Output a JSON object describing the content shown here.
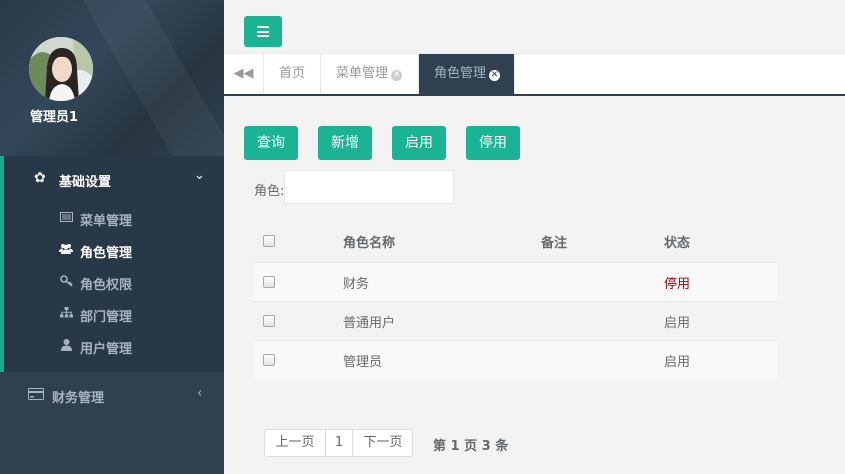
{
  "profile": {
    "name": "管理员1"
  },
  "sidebar": {
    "group": {
      "label": "基础设置",
      "items": [
        {
          "label": "菜单管理",
          "icon": "list-icon"
        },
        {
          "label": "角色管理",
          "icon": "users-icon"
        },
        {
          "label": "角色权限",
          "icon": "key-icon"
        },
        {
          "label": "部门管理",
          "icon": "sitemap-icon"
        },
        {
          "label": "用户管理",
          "icon": "user-icon"
        }
      ]
    },
    "finance": {
      "label": "财务管理",
      "icon": "credit-card-icon"
    }
  },
  "tabs": {
    "items": [
      {
        "label": "首页"
      },
      {
        "label": "菜单管理"
      },
      {
        "label": "角色管理"
      }
    ],
    "active": "角色管理"
  },
  "toolbar": {
    "query": "查询",
    "add": "新增",
    "enable": "启用",
    "disable": "停用"
  },
  "filter": {
    "role_label": "角色:",
    "role_value": ""
  },
  "table": {
    "headers": {
      "name": "角色名称",
      "remark": "备注",
      "status": "状态"
    },
    "rows": [
      {
        "name": "财务",
        "remark": "",
        "status": "停用"
      },
      {
        "name": "普通用户",
        "remark": "",
        "status": "启用"
      },
      {
        "name": "管理员",
        "remark": "",
        "status": "启用"
      }
    ]
  },
  "pagination": {
    "prev": "上一页",
    "current": "1",
    "next": "下一页",
    "info": "第 1 页 3 条"
  },
  "colors": {
    "accent": "#1ab394",
    "sidebar": "#2f4050",
    "disabled_status": "#b20000"
  }
}
